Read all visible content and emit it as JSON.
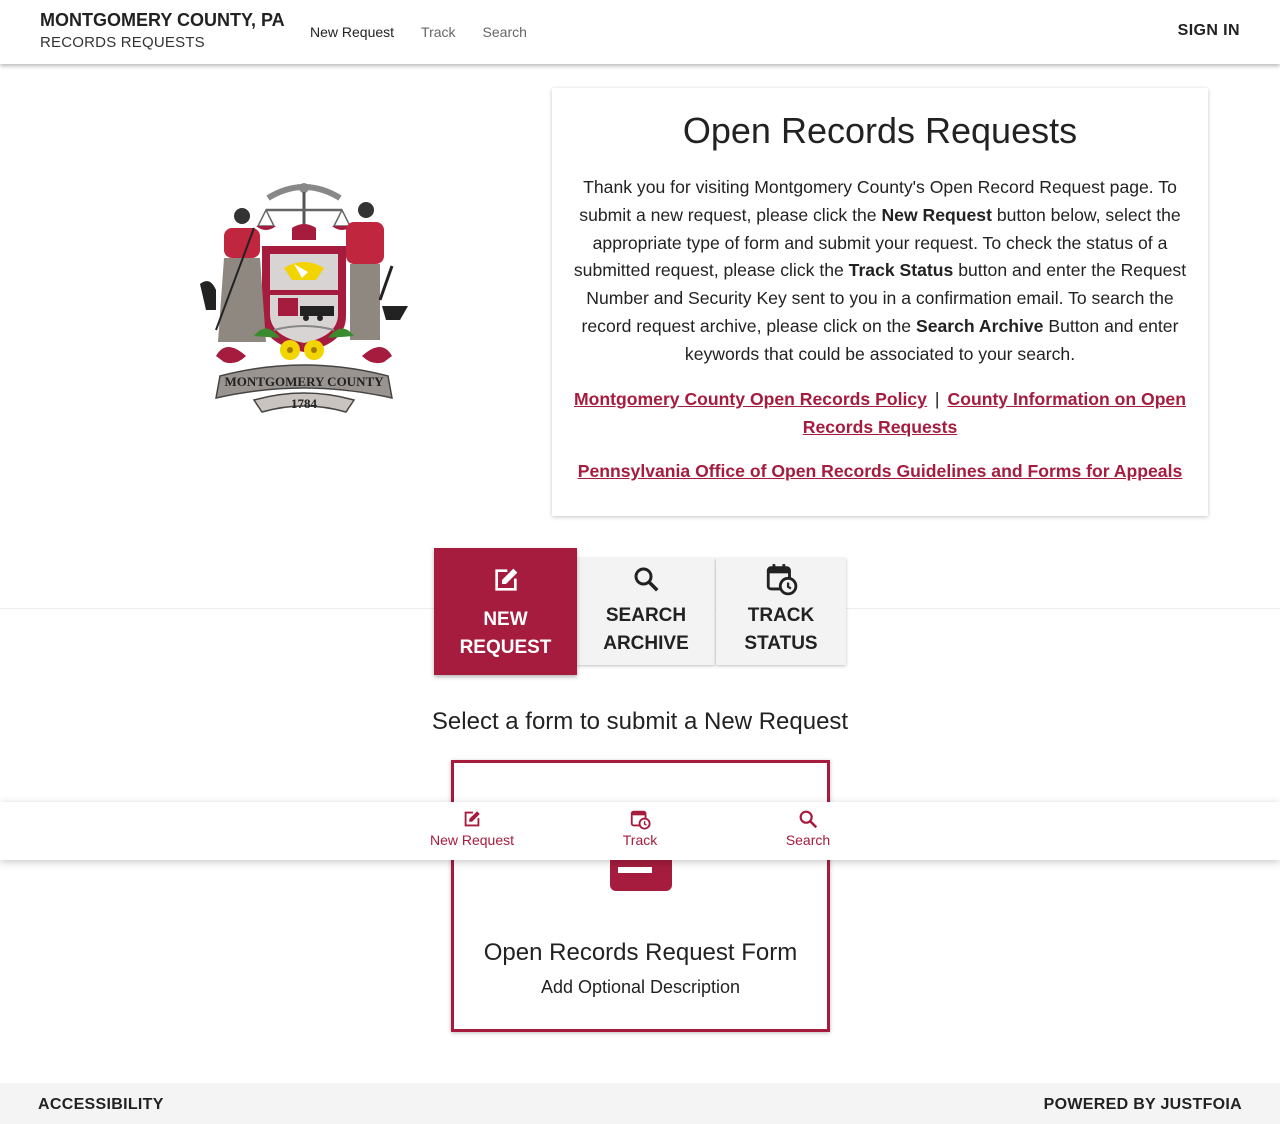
{
  "header": {
    "brand_title": "MONTGOMERY COUNTY, PA",
    "brand_subtitle": "RECORDS REQUESTS",
    "nav": [
      "New Request",
      "Track",
      "Search"
    ],
    "sign_in": "SIGN IN"
  },
  "seal": {
    "county_name": "MONTGOMERY COUNTY",
    "year": "1784"
  },
  "info": {
    "title": "Open Records Requests",
    "para_1": "Thank you for visiting Montgomery County's Open Record Request page. To submit a new request, please click the ",
    "bold_1": "New Request",
    "para_2": " button below, select the appropriate type of form and submit your request. To check the status of a submitted request, please click the ",
    "bold_2": "Track Status",
    "para_3": " button and enter the Request Number and Security Key sent to you in a confirmation email. To search the record request archive, please click on the ",
    "bold_3": "Search Archive",
    "para_4": " Button and enter keywords that could be associated to your search.",
    "link_policy": "Montgomery County Open Records Policy",
    "separator": "|",
    "link_county_info": "County Information on Open Records Requests",
    "link_appeals": "Pennsylvania Office of Open Records Guidelines and Forms for Appeals"
  },
  "tabs": {
    "new_line1": "NEW",
    "new_line2": "REQUEST",
    "search_line1": "SEARCH",
    "search_line2": "ARCHIVE",
    "track_line1": "TRACK",
    "track_line2": "STATUS"
  },
  "main": {
    "select_heading": "Select a form to submit a New Request",
    "form_title": "Open Records Request Form",
    "form_description": "Add Optional Description"
  },
  "bottom_nav": {
    "new_request": "New Request",
    "track": "Track",
    "search": "Search"
  },
  "footer": {
    "accessibility": "ACCESSIBILITY",
    "powered_by": "POWERED BY JUSTFOIA"
  },
  "colors": {
    "brand": "#a51c3e",
    "tab_inactive": "#f3f3f3",
    "footer_bg": "#f4f4f4"
  }
}
